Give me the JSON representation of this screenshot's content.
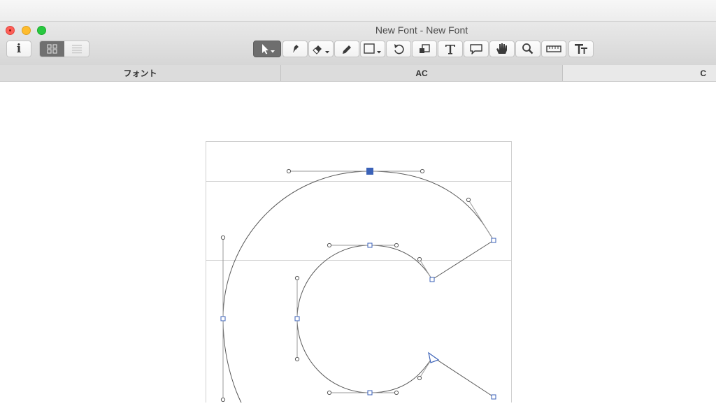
{
  "window": {
    "title": "New Font - New Font"
  },
  "toolbar": {
    "info_label": "i",
    "view_modes": [
      "grid-view",
      "list-view"
    ],
    "active_view": "grid-view",
    "tools": [
      {
        "name": "pointer-tool",
        "icon": "arrow-pointer-icon",
        "selected": true
      },
      {
        "name": "pen-tool",
        "icon": "pen-nib-icon",
        "selected": false
      },
      {
        "name": "eraser-tool",
        "icon": "eraser-icon",
        "selected": false
      },
      {
        "name": "pencil-tool",
        "icon": "pencil-icon",
        "selected": false
      },
      {
        "name": "rectangle-tool",
        "icon": "rectangle-icon",
        "selected": false
      },
      {
        "name": "rotate-tool",
        "icon": "rotate-icon",
        "selected": false
      },
      {
        "name": "scale-tool",
        "icon": "scale-icon",
        "selected": false
      },
      {
        "name": "text-tool",
        "icon": "text-t-icon",
        "selected": false
      },
      {
        "name": "annotation-tool",
        "icon": "speech-bubble-icon",
        "selected": false
      },
      {
        "name": "hand-tool",
        "icon": "hand-icon",
        "selected": false
      },
      {
        "name": "zoom-tool",
        "icon": "magnifier-icon",
        "selected": false
      },
      {
        "name": "measure-tool",
        "icon": "ruler-icon",
        "selected": false
      },
      {
        "name": "glyph-info-tool",
        "icon": "text-size-icon",
        "selected": false
      }
    ]
  },
  "tabs": [
    {
      "label": "フォント",
      "active": false
    },
    {
      "label": "AC",
      "active": false
    },
    {
      "label": "C",
      "active": true
    }
  ],
  "editor": {
    "glyph": "C",
    "accent_color": "#3b62b8",
    "outline_color": "#5a5a5a",
    "guide_color": "#cfcfcf"
  }
}
